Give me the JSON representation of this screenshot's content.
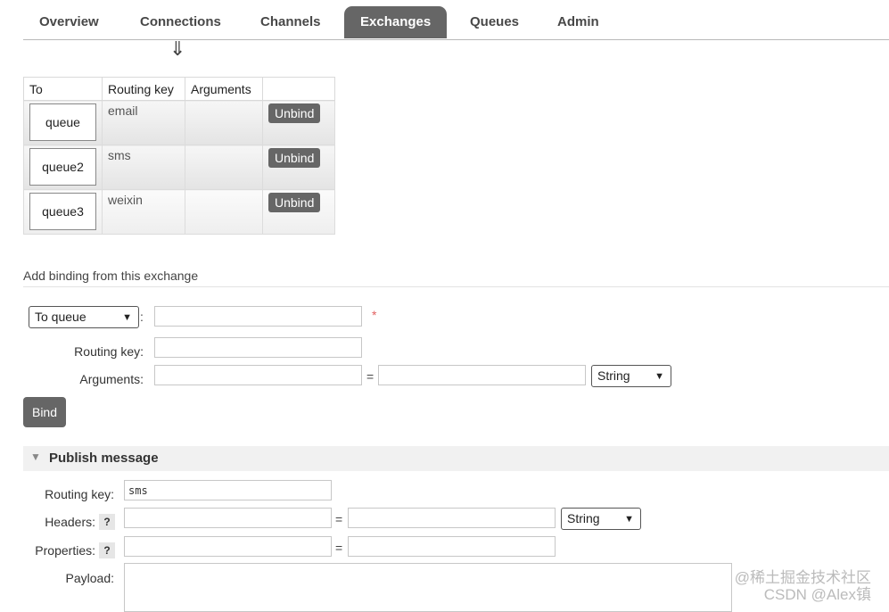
{
  "nav": {
    "tabs": [
      "Overview",
      "Connections",
      "Channels",
      "Exchanges",
      "Queues",
      "Admin"
    ],
    "active": "Exchanges",
    "arrow_glyph": "⇓"
  },
  "bindings": {
    "headers": [
      "To",
      "Routing key",
      "Arguments",
      ""
    ],
    "rows": [
      {
        "to": "queue",
        "routing_key": "email",
        "arguments": "",
        "action": "Unbind"
      },
      {
        "to": "queue2",
        "routing_key": "sms",
        "arguments": "",
        "action": "Unbind"
      },
      {
        "to": "queue3",
        "routing_key": "weixin",
        "arguments": "",
        "action": "Unbind"
      }
    ]
  },
  "add_binding": {
    "title": "Add binding from this exchange",
    "destination_type": "To queue",
    "destination_value": "",
    "required_mark": "*",
    "colon": ":",
    "routing_key_label": "Routing key:",
    "routing_key_value": "",
    "arguments_label": "Arguments:",
    "arg_key": "",
    "arg_value": "",
    "equals": "=",
    "arg_type": "String",
    "bind_label": "Bind"
  },
  "publish": {
    "title": "Publish message",
    "routing_key_label": "Routing key:",
    "routing_key_value": "sms",
    "headers_label": "Headers:",
    "header_key": "",
    "header_value": "",
    "header_type": "String",
    "properties_label": "Properties:",
    "property_key": "",
    "property_value": "",
    "payload_label": "Payload:",
    "payload_value": "",
    "help_glyph": "?",
    "equals": "="
  },
  "watermark": {
    "line1": "@稀土掘金技术社区",
    "line2": "CSDN @Alex镇"
  },
  "colors": {
    "active_tab": "#666666",
    "button": "#666666",
    "required": "#e26060"
  }
}
